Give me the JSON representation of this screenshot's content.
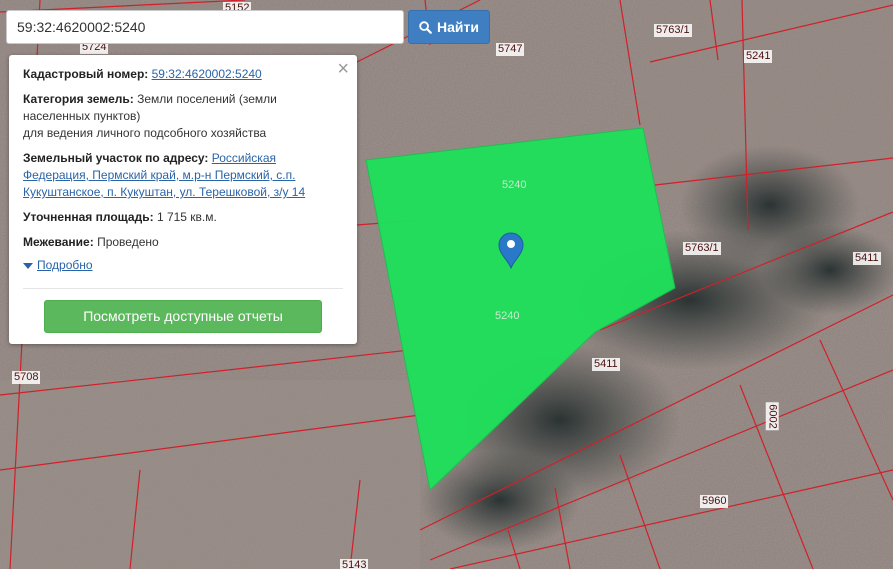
{
  "search": {
    "value": "59:32:4620002:5240",
    "button_label": "Найти"
  },
  "popup": {
    "cadastral_label": "Кадастровый номер:",
    "cadastral_value": "59:32:4620002:5240",
    "category_label": "Категория земель:",
    "category_value_1": "Земли поселений (земли",
    "category_value_2": "населенных пунктов)",
    "category_value_3": "для ведения личного подсобного хозяйства",
    "address_label": "Земельный участок по адресу:",
    "address_value_1": "Российская",
    "address_value_2": "Федерация, Пермский край, м.р-н Пермский, с.п.",
    "address_value_3": "Кукуштанское, п. Кукуштан, ул. Терешковой, з/у 14",
    "area_label": "Уточненная площадь:",
    "area_value": "1 715 кв.м.",
    "survey_label": "Межевание:",
    "survey_value": "Проведено",
    "more_label": "Подробно",
    "report_button": "Посмотреть доступные отчеты",
    "close_icon": "close-icon"
  },
  "map": {
    "parcel_color": "#1fe05a",
    "boundary_color": "#d0202a",
    "plot_labels": {
      "l5152": "5152",
      "l5724": "5724",
      "l5747": "5747",
      "l5763a": "5763/1",
      "l5241": "5241",
      "l5240a": "5240",
      "l5763b": "5763/1",
      "l5411a": "5411",
      "l5240b": "5240",
      "l5411b": "5411",
      "l5708": "5708",
      "l6002": "6002",
      "l5960": "5960",
      "l5143": "5143"
    },
    "marker_icon": "map-pin-icon"
  },
  "colors": {
    "button_blue": "#3f7fc1",
    "button_green": "#5cb85c",
    "link": "#2a64a8"
  }
}
